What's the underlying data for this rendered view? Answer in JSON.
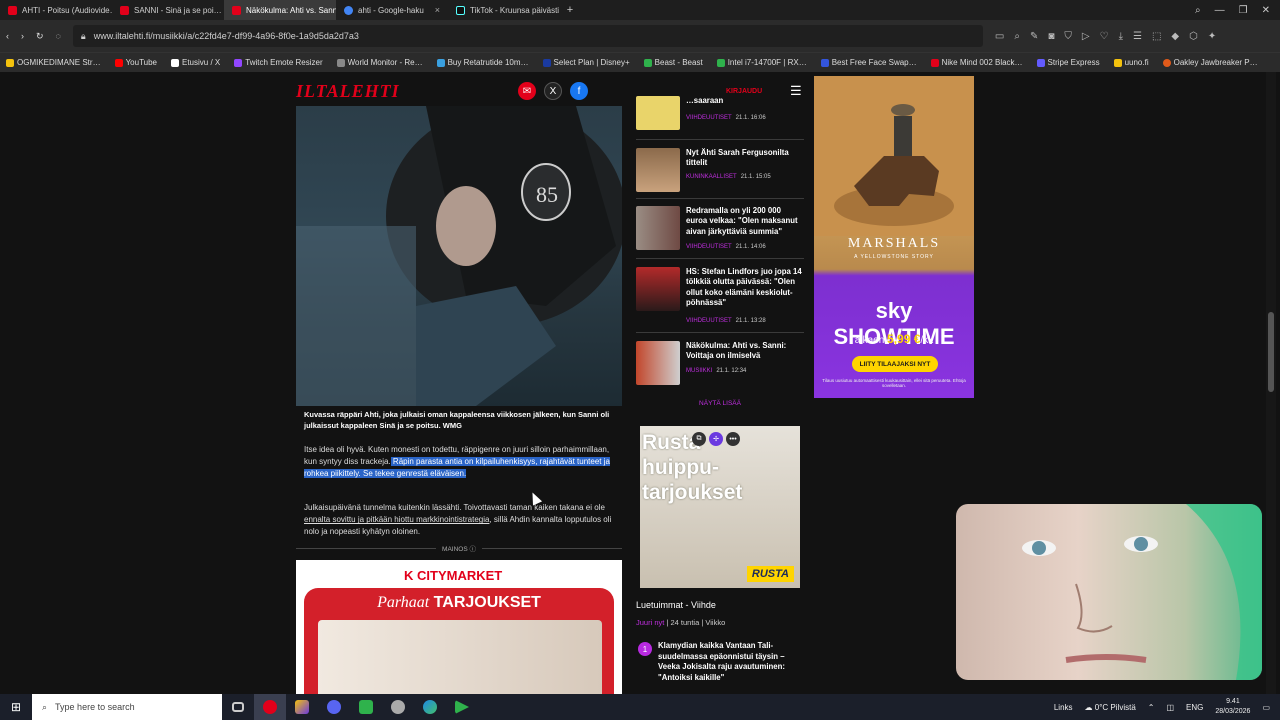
{
  "browser": {
    "tabs": [
      {
        "label": "AHTI - Poitsu (Audiovide…",
        "color": "#e2001a",
        "active": false
      },
      {
        "label": "SANNI - Sinä ja se poi…",
        "color": "#e2001a",
        "active": false
      },
      {
        "label": "Näkökulma: Ahti vs. Sanni",
        "color": "#e2001a",
        "active": true
      },
      {
        "label": "ahti - Google-haku",
        "color": "#4285f4",
        "active": false
      },
      {
        "label": "TikTok - Kruunsa päivästi",
        "color": "#111111",
        "active": false
      }
    ],
    "new_tab": "+",
    "url": "www.iltalehti.fi/musiikki/a/c22fd4e7-df99-4a96-8f0e-1a9d5da2d7a3",
    "bookmarks": [
      {
        "label": "OGMIKEDIMANE Str…",
        "color": "#f4c20d"
      },
      {
        "label": "YouTube",
        "color": "#ff0000"
      },
      {
        "label": "Etusivu / X",
        "color": "#ffffff"
      },
      {
        "label": "Twitch Emote Resizer",
        "color": "#9146ff"
      },
      {
        "label": "World Monitor - Re…",
        "color": "#888888"
      },
      {
        "label": "Buy Retatrutide 10m…",
        "color": "#3aa0e0"
      },
      {
        "label": "Select Plan | Disney+",
        "color": "#1a3aa0"
      },
      {
        "label": "Beast - Beast",
        "color": "#2fb24c"
      },
      {
        "label": "Intel i7-14700F | RX…",
        "color": "#2fb24c"
      },
      {
        "label": "Best Free Face Swap…",
        "color": "#3355dd"
      },
      {
        "label": "Nike Mind 002 Black…",
        "color": "#e2001a"
      },
      {
        "label": "Stripe Express",
        "color": "#635bff"
      },
      {
        "label": "uuno.fi",
        "color": "#f4c20d"
      },
      {
        "label": "Oakley Jawbreaker P…",
        "color": "#e05a1a"
      }
    ]
  },
  "site": {
    "logo": "ILTALEHTI",
    "login": "KIRJAUDU",
    "menu_icon": "☰"
  },
  "article": {
    "caption": "Kuvassa räppäri Ahti, joka julkaisi oman kappaleensa viikkosen jälkeen, kun Sanni oli julkaissut kappaleen Sinä ja se poitsu. WMG",
    "p1_plain": "Itse idea oli hyvä. Kuten monesti on todettu, räppigenre on juuri silloin parhaimmillaan, kun syntyy diss trackeja.",
    "p1_highlight": " Räpin parasta antia on kilpailuhenkisyys, rajahtävät tunteet ja rohkea piikittely. Se tekee genrestä eläväisen.",
    "p2_start": "Julkaisupäivänä tunnelma kuitenkin lässähti. Toivottavasti taman kaiken takana ei ole ",
    "p2_link": "ennalta sovittu ja pitkään hiottu markkinointistrategia",
    "p2_end": ", sillä Ahdin kannalta lopputulos oli nolo ja nopeasti kyhätyn oloinen.",
    "ad_label": "MAINOS ⓘ"
  },
  "citymarket_ad": {
    "logo": "K CITYMARKET",
    "title_script": "Parhaat",
    "title_bold": "TARJOUKSET"
  },
  "sidebar_news": [
    {
      "title": "…saaraan",
      "category": "VIIHDEUUTISET",
      "time": "21.1. 16:06",
      "color": "#e9d46a"
    },
    {
      "title": "Nyt Ähti Sarah Fergusonilta tittelit",
      "category": "KUNINKAALLISET",
      "time": "21.1. 15:05",
      "color": "#b08f6a"
    },
    {
      "title": "Redramalla on yli 200 000 euroa velkaa: \"Olen maksanut aivan järkyttäviä summia\"",
      "category": "VIIHDEUUTISET",
      "time": "21.1. 14:06",
      "color": "#9a8d84"
    },
    {
      "title": "HS: Stefan Lindfors juo jopa 14 tölkkiä olutta päivässä: \"Olen ollut koko elämäni keskiolut-pöhnässä\"",
      "category": "VIIHDEUUTISET",
      "time": "21.1. 13:28",
      "color": "#b32a2a"
    },
    {
      "title": "Näkökulma: Ahti vs. Sanni: Voittaja on ilmiselvä",
      "category": "MUSIIKKI",
      "time": "21.1. 12:34",
      "color": "#c2462b"
    }
  ],
  "show_more": "NÄYTÄ LISÄÄ",
  "rusta_ad": {
    "text_line1": "Rusta",
    "text_line2": "huippu-",
    "text_line3": "tarjoukset",
    "logo": "RUSTA"
  },
  "most_read": {
    "title": "Luetuimmat - Viihde",
    "tab_active": "Juuri nyt",
    "tab_24h": "24 tuntia",
    "tab_week": "Viikko",
    "item1_rank": "1",
    "item1_text": "Klamydian kaikka Vantaan Tali-suudelmassa epäonnistui täysin – Veeka Jokisalta raju avautuminen: \"Antoiksi kaikille\""
  },
  "sky_ad": {
    "show_title": "MARSHALS",
    "show_sub": "A YELLOWSTONE STORY",
    "brand": "sky SHOWTIME",
    "price_prefix": "alkaen",
    "price": "5,99 €",
    "price_suffix": "/kk",
    "cta": "LIITY TILAAJAKSI NYT",
    "fine": "Tilaus uusiutuu automaattisesti kuukausittain, ellei sitä peruuteta. Ehtoja sovelletaan."
  },
  "taskbar": {
    "search_placeholder": "Type here to search",
    "links": "Links",
    "weather": "0°C Pilvistä",
    "lang": "ENG",
    "time": "9.41",
    "date": "28/03/2026"
  }
}
